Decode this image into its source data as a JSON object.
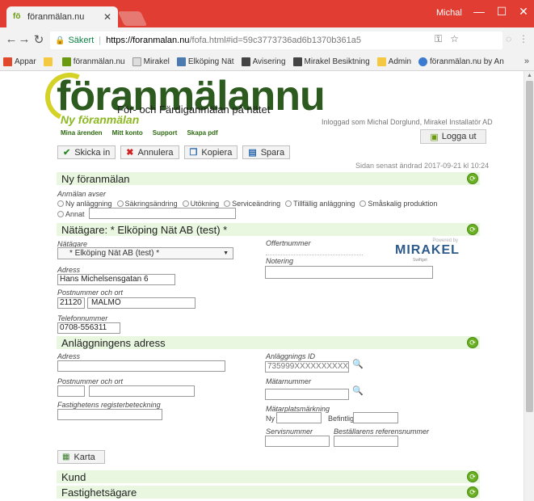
{
  "browser": {
    "tab_title": "föranmälan.nu",
    "user": "Michal",
    "secure_label": "Säkert",
    "url_host": "https://foranmalan.nu",
    "url_path": "/fofa.html#id=59c3773736ad6b1370b361a5",
    "bookmarks": [
      {
        "label": "Appar",
        "icon": "apps-grid-icon",
        "color": "#e04a2a"
      },
      {
        "label": "",
        "icon": "folder-icon",
        "color": "#f5c842"
      },
      {
        "label": "föranmälan.nu",
        "icon": "foranmalan-icon",
        "color": "#6a9a10"
      },
      {
        "label": "Mirakel",
        "icon": "page-icon",
        "color": "#cccccc"
      },
      {
        "label": "Elköping Nät",
        "icon": "elkoping-icon",
        "color": "#4a7ab0"
      },
      {
        "label": "Avisering",
        "icon": "mirakel-icon",
        "color": "#444444"
      },
      {
        "label": "Mirakel Besiktning",
        "icon": "mirakel-icon",
        "color": "#444444"
      },
      {
        "label": "Admin",
        "icon": "folder-icon",
        "color": "#f5c842"
      },
      {
        "label": "föranmälan.nu by An",
        "icon": "globe-icon",
        "color": "#3a7ad0"
      }
    ],
    "more": "»"
  },
  "header": {
    "logo": "föranmälannu",
    "tagline": "För- och Färdiganmälan på nätet",
    "subtitle": "Ny föranmälan",
    "logged_in": "Inloggad som Michal Dorglund, Mirakel Installatör AD",
    "links": [
      "Mina ärenden",
      "Mitt konto",
      "Support",
      "Skapa pdf"
    ],
    "logout": "Logga ut"
  },
  "actions": [
    {
      "label": "Skicka in",
      "icon": "check-icon",
      "color": "#2d8a2d"
    },
    {
      "label": "Annulera",
      "icon": "x-icon",
      "color": "#d02020"
    },
    {
      "label": "Kopiera",
      "icon": "copy-icon",
      "color": "#2d6ab0"
    },
    {
      "label": "Spara",
      "icon": "save-icon",
      "color": "#2d6ab0"
    }
  ],
  "last_changed": "Sidan senast ändrad 2017-09-21 kl 10:24",
  "sections": {
    "ny": "Ny föranmälan",
    "natagare": "Nätägare: * Elköping Nät AB (test) *",
    "anlaggning": "Anläggningens adress",
    "kund": "Kund",
    "fastighet": "Fastighetsägare"
  },
  "anmalan": {
    "label": "Anmälan avser",
    "options": [
      "Ny anläggning",
      "Säkringsändring",
      "Utökning",
      "Serviceändring",
      "Tillfällig anläggning",
      "Småskalig produktion"
    ],
    "other": "Annat"
  },
  "natagare": {
    "natagare_label": "Nätägare",
    "natagare_value": "* Elköping Nät AB (test) *",
    "offert_label": "Offertnummer",
    "notering_label": "Notering",
    "adress_label": "Adress",
    "adress_value": "Hans Michelsensgatan 6",
    "postnr_label": "Postnummer och ort",
    "postnr_value": "21120",
    "ort_value": "MALMÖ",
    "telefon_label": "Telefonnummer",
    "telefon_value": "0708-556311",
    "powered_by": "Powered by",
    "brand": "MIRAKEL",
    "brand_sub": "Swiftget"
  },
  "anlaggning": {
    "adress_label": "Adress",
    "postnr_label": "Postnummer och ort",
    "fastighet_label": "Fastighetens registerbeteckning",
    "id_label": "Anläggnings ID",
    "id_value": "735999XXXXXXXXXXXX",
    "matar_label": "Mätarnummer",
    "markning_label": "Mätarplatsmärkning",
    "ny_label": "Ny",
    "befintlig_label": "Befintlig",
    "service_label": "Servisnummer",
    "bestallare_label": "Beställarens referensnummer",
    "karta": "Karta"
  }
}
